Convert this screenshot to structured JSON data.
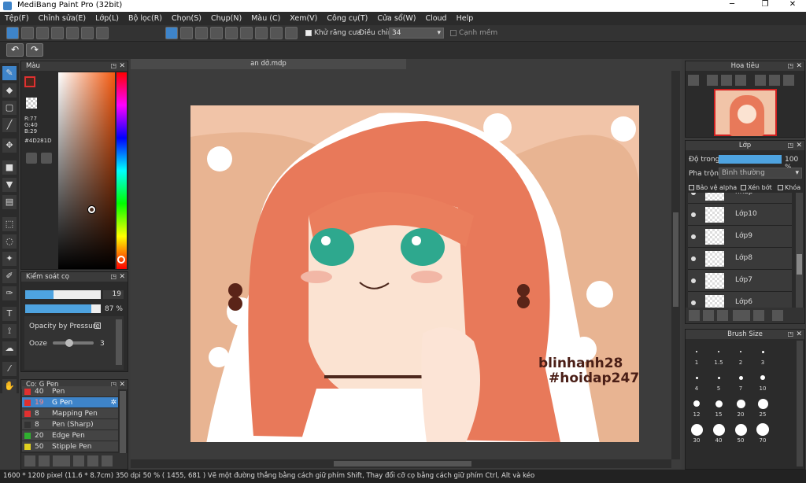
{
  "app": {
    "title": "MediBang Paint Pro (32bit)"
  },
  "window_controls": {
    "min": "─",
    "max": "❐",
    "close": "✕"
  },
  "menu": [
    "Tệp(F)",
    "Chỉnh sửa(E)",
    "Lớp(L)",
    "Bộ lọc(R)",
    "Chọn(S)",
    "Chụp(N)",
    "Màu (C)",
    "Xem(V)",
    "Công cụ(T)",
    "Cửa sổ(W)",
    "Cloud",
    "Help"
  ],
  "toolbar": {
    "antialias_label": "Khử răng cưa",
    "adjust_label": "Điều chỉnh",
    "adjust_value": "34",
    "smooth_label": "Cạnh mềm"
  },
  "undo": {
    "undo": "↶",
    "redo": "↷"
  },
  "color_panel": {
    "title": "Màu",
    "r": "R:77",
    "g": "G:40",
    "b": "B:29",
    "hex": "#4D281D",
    "fg_color": "#4D281D"
  },
  "brush_control": {
    "title": "Kiểm soát cọ",
    "size_value": "19",
    "size_fraction": 0.38,
    "opacity_value": "87 %",
    "opacity_fraction": 0.87,
    "opacity_by_pressure": "Opacity by Pressure",
    "ooze_label": "Ooze",
    "ooze_value": "3",
    "ooze_fraction": 0.3
  },
  "brush_list": {
    "title": "Cọ: G Pen",
    "items": [
      {
        "size": "40",
        "name": "Pen",
        "color": "#e03030",
        "selected": false
      },
      {
        "size": "19",
        "name": "G Pen",
        "color": "#e03030",
        "selected": true
      },
      {
        "size": "8",
        "name": "Mapping Pen",
        "color": "#e03030",
        "selected": false
      },
      {
        "size": "8",
        "name": "Pen (Sharp)",
        "color": "#333333",
        "selected": false
      },
      {
        "size": "20",
        "name": "Edge Pen",
        "color": "#30b030",
        "selected": false
      },
      {
        "size": "50",
        "name": "Stipple Pen",
        "color": "#e0d020",
        "selected": false
      }
    ]
  },
  "document": {
    "tab": "an dở.mdp"
  },
  "canvas": {
    "watermark1": "blinhanh28",
    "watermark2": "#hoidap247"
  },
  "navigator": {
    "title": "Hoa tiêu"
  },
  "layer_panel": {
    "title": "Lớp",
    "opacity_label": "Độ trong",
    "opacity_value": "100 %",
    "opacity_fraction": 1.0,
    "blend_label": "Pha trộn",
    "blend_value": "Bình thường",
    "protect_alpha": "Bảo vệ alpha",
    "clip": "Xén bớt",
    "lock": "Khóa",
    "layers": [
      "nháp",
      "Lớp10",
      "Lớp9",
      "Lớp8",
      "Lớp7",
      "Lớp6"
    ]
  },
  "brush_size": {
    "title": "Brush Size",
    "rows": [
      [
        "1",
        "1.5",
        "2",
        "3"
      ],
      [
        "4",
        "5",
        "7",
        "10"
      ],
      [
        "12",
        "15",
        "20",
        "25"
      ],
      [
        "30",
        "40",
        "50",
        "70"
      ]
    ]
  },
  "status": {
    "text": "1600 * 1200 pixel   (11.6 * 8.7cm)   350 dpi   50 %   ( 1455, 681 )   Vẽ một đường thẳng bằng cách giữ phím Shift, Thay đổi cỡ cọ bằng cách giữ phím Ctrl, Alt và kéo"
  },
  "colors": {
    "accent": "#3e84c9",
    "panel": "#2b2b2b"
  }
}
